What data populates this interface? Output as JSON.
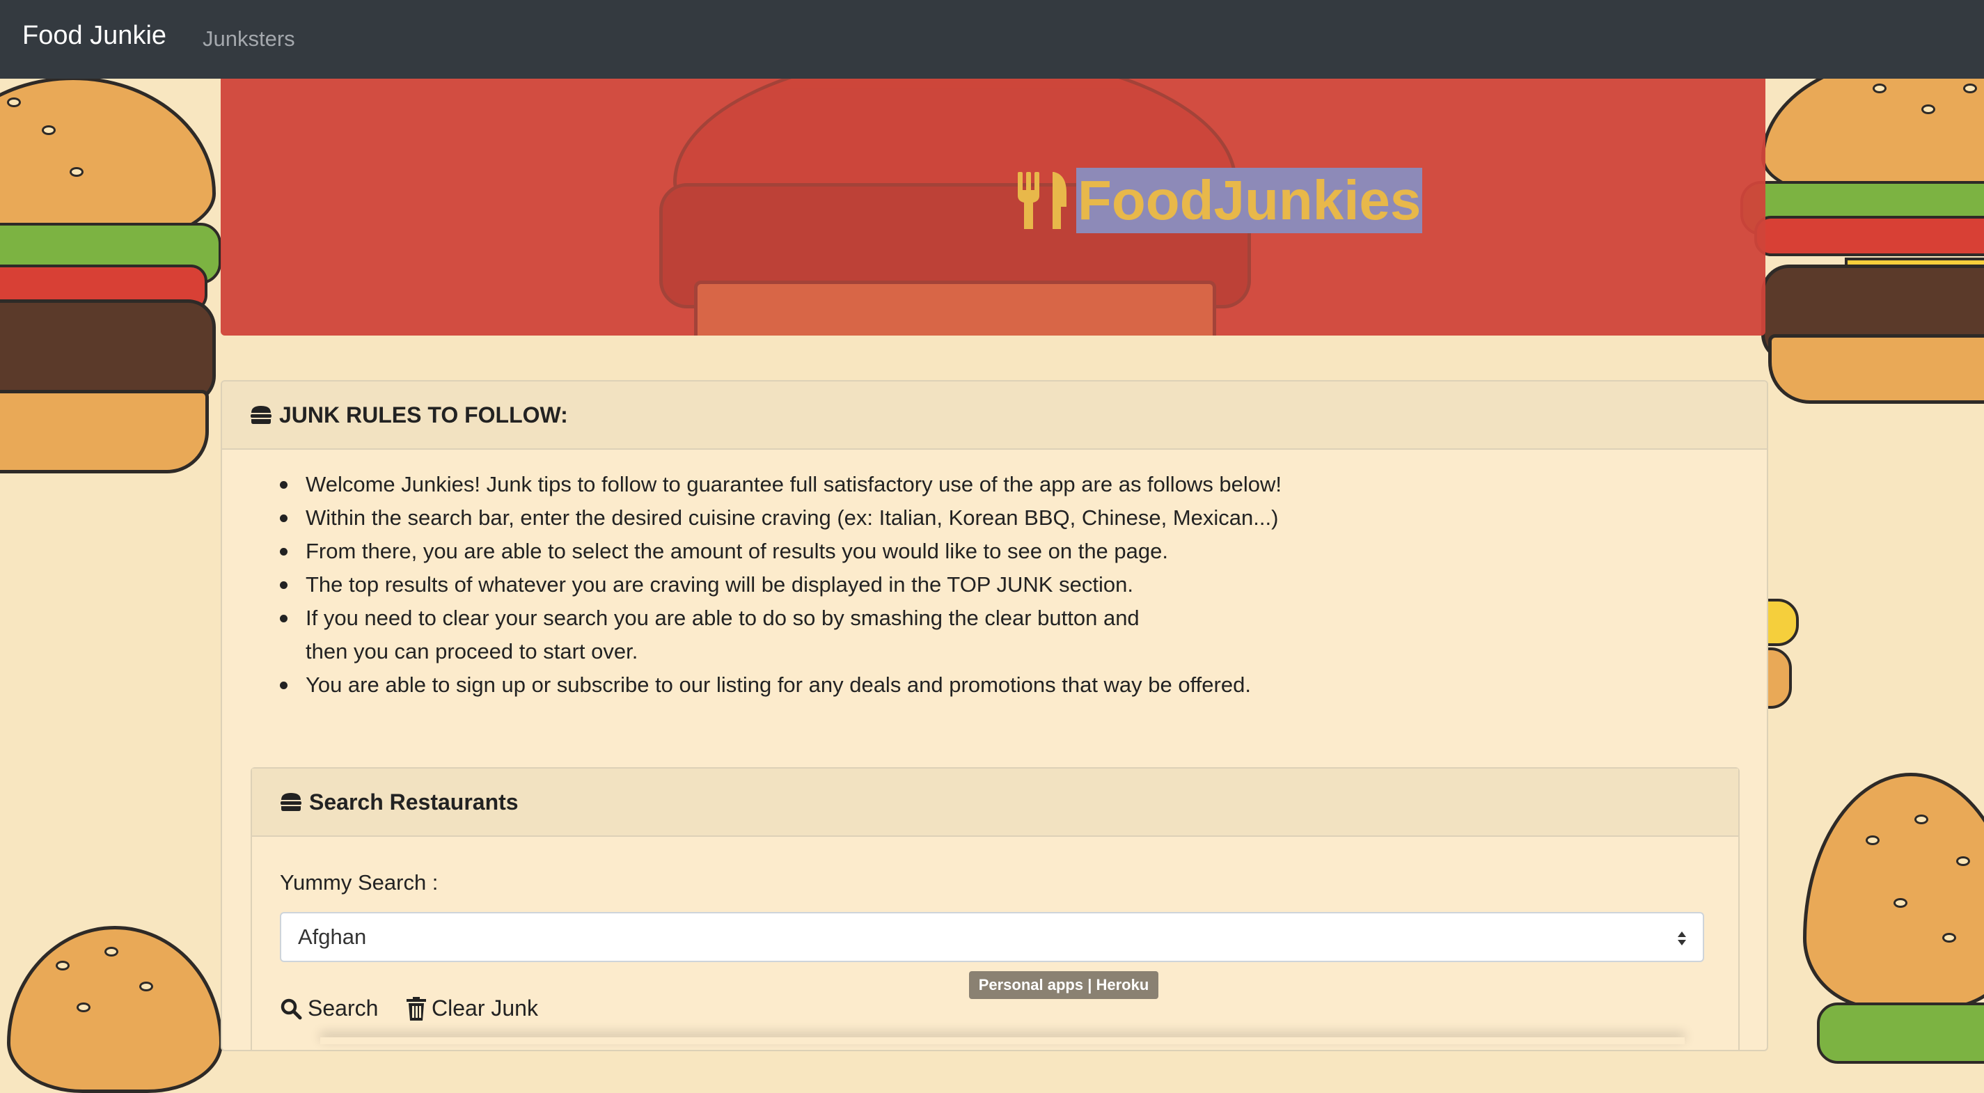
{
  "navbar": {
    "brand": "Food Junkie",
    "links": [
      "Junksters"
    ]
  },
  "hero": {
    "icon": "utensils-icon",
    "title": "FoodJunkies"
  },
  "rules_card": {
    "icon": "burger-icon",
    "header": "JUNK RULES TO FOLLOW:",
    "rules": [
      "Welcome Junkies! Junk tips to follow to guarantee full satisfactory use of the app are as follows below!",
      "Within the search bar, enter the desired cuisine craving (ex: Italian, Korean BBQ, Chinese, Mexican...)",
      "From there, you are able to select the amount of results you would like to see on the page.",
      "The top results of whatever you are craving will be displayed in the TOP JUNK section.",
      "If you need to clear your search you are able to do so by smashing the clear button and",
      "then you can proceed to start over.",
      "You are able to sign up or subscribe to our listing for any deals and promotions that way be offered."
    ]
  },
  "search_card": {
    "icon": "burger-icon",
    "header": "Search Restaurants",
    "label": "Yummy Search :",
    "selected": "Afghan",
    "search_button": "Search",
    "clear_button": "Clear Junk"
  },
  "tooltip": "Personal apps | Heroku",
  "colors": {
    "navbar": "#343a40",
    "hero": "#d0453a",
    "hero_title": "#e8b84a",
    "selection_highlight": "#8d8ab8",
    "background": "#f8e6c0"
  }
}
